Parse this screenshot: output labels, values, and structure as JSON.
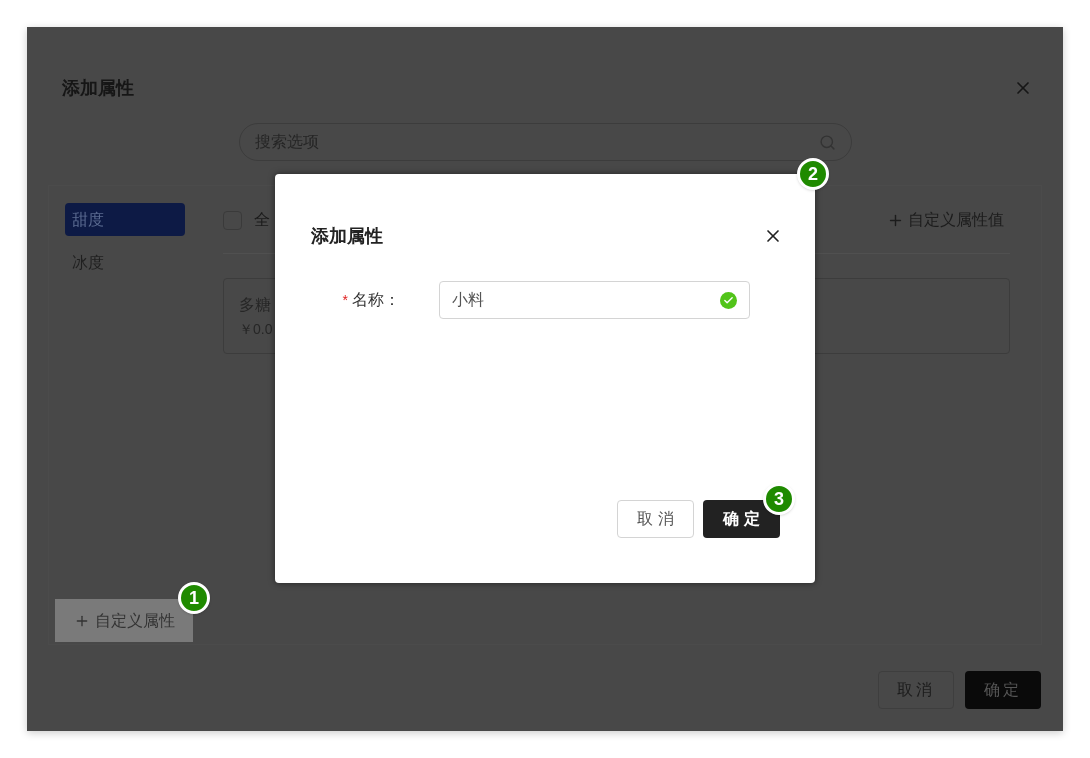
{
  "background_dialog": {
    "title": "添加属性",
    "search": {
      "placeholder": "搜索选项"
    },
    "categories": [
      {
        "label": "甜度",
        "selected": true
      },
      {
        "label": "冰度",
        "selected": false
      }
    ],
    "select_all": {
      "label": "全",
      "checked": false
    },
    "add_value_button": "自定义属性值",
    "options": [
      {
        "name": "多糖",
        "price": "￥0.0"
      }
    ],
    "add_attribute_button": {
      "label": "自定义属性",
      "highlighted": true,
      "marker": "1"
    },
    "buttons": [
      {
        "label": "取消",
        "kind": "secondary"
      },
      {
        "label": "确定",
        "kind": "primary"
      }
    ]
  },
  "modal": {
    "title": "添加属性",
    "marker": "2",
    "fields": [
      {
        "label": "名称：",
        "required": true,
        "required_mark": "*",
        "value": "小料",
        "valid": true
      }
    ],
    "buttons": [
      {
        "label": "取 消",
        "kind": "secondary"
      },
      {
        "label": "确 定",
        "kind": "primary",
        "marker": "3"
      }
    ]
  }
}
